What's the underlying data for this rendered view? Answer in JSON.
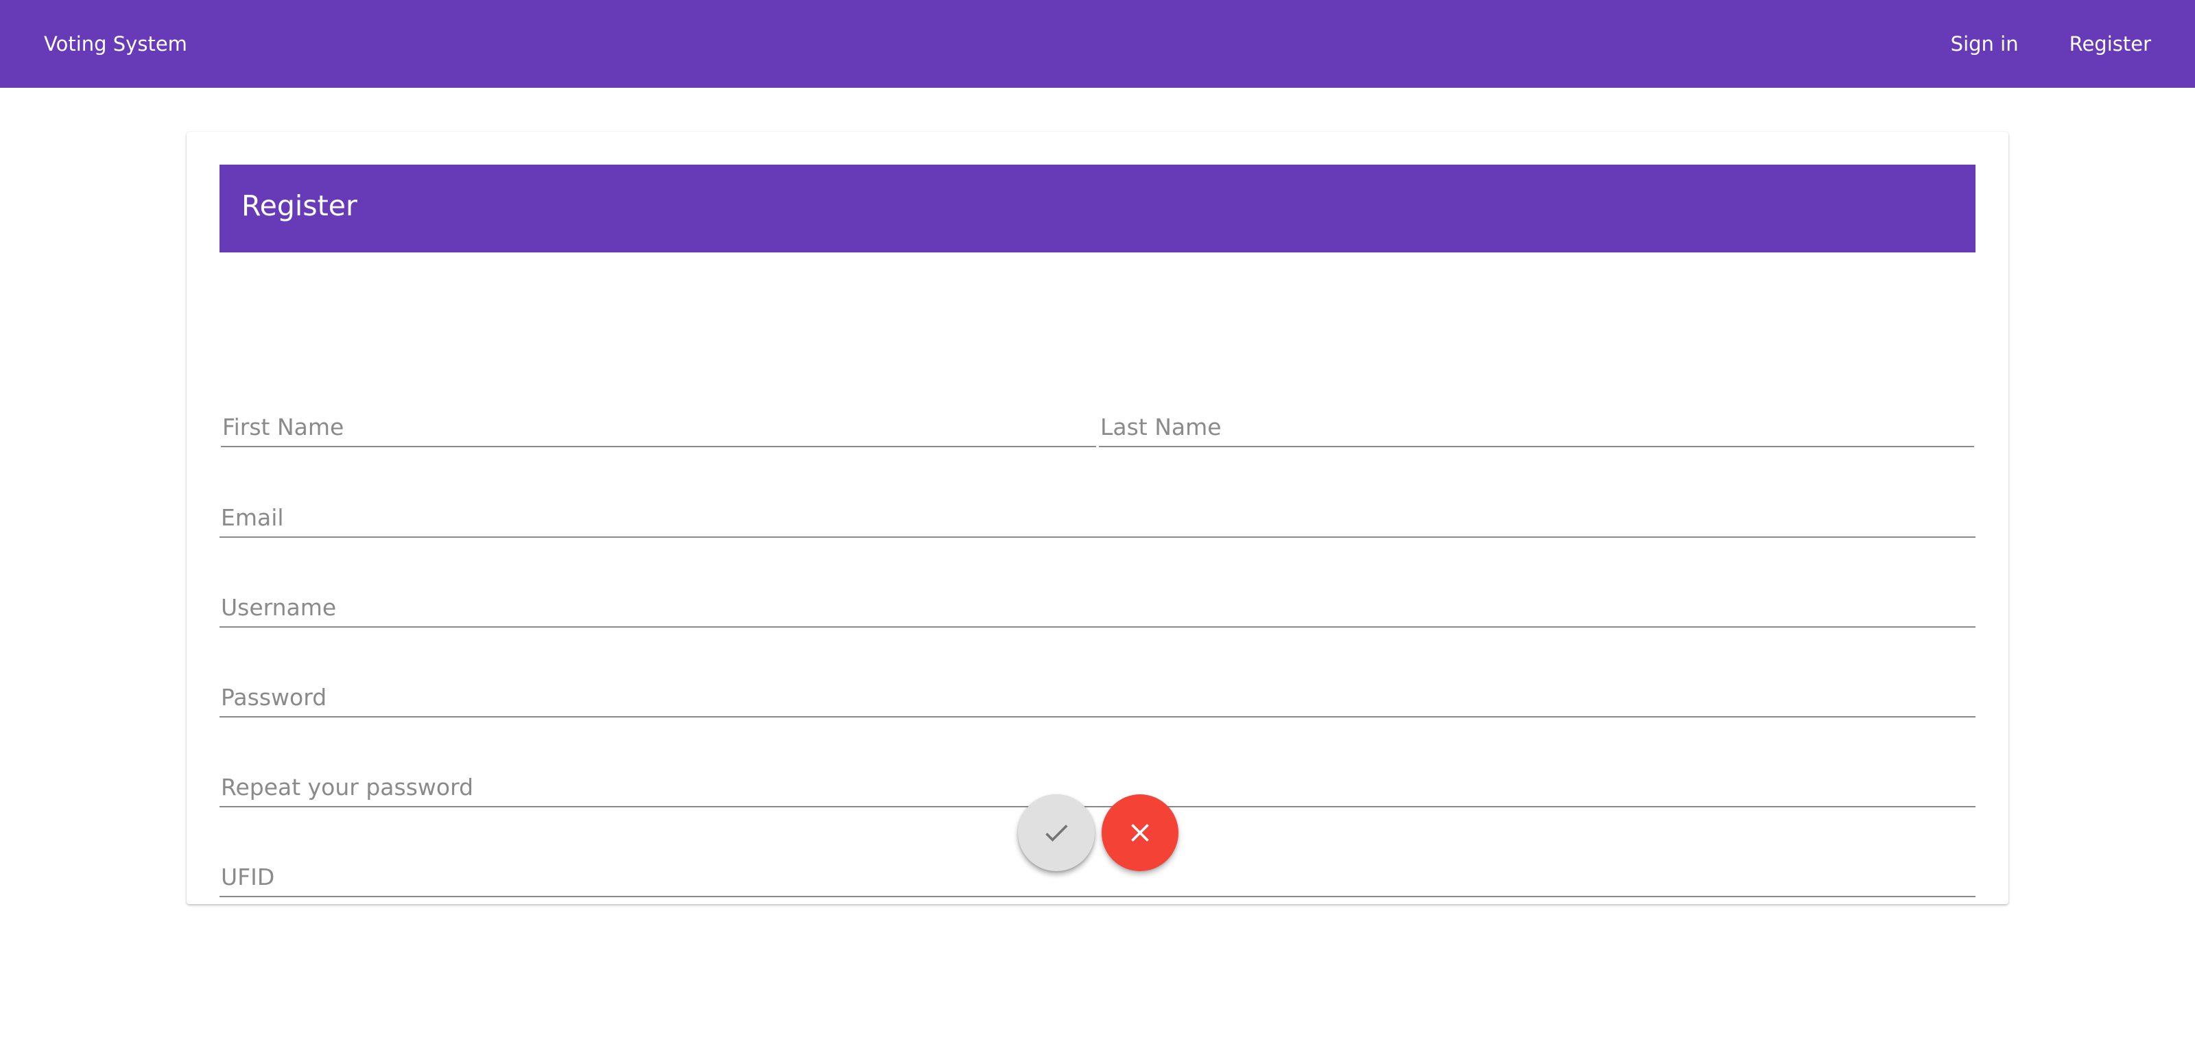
{
  "app": {
    "title": "Voting System",
    "nav": {
      "sign_in": "Sign in",
      "register": "Register"
    }
  },
  "form": {
    "title": "Register",
    "fields": {
      "first_name": {
        "placeholder": "First Name",
        "value": ""
      },
      "last_name": {
        "placeholder": "Last Name",
        "value": ""
      },
      "email": {
        "placeholder": "Email",
        "value": ""
      },
      "username": {
        "placeholder": "Username",
        "value": ""
      },
      "password": {
        "placeholder": "Password",
        "value": ""
      },
      "repeat_password": {
        "placeholder": "Repeat your password",
        "value": ""
      },
      "ufid": {
        "placeholder": "UFID",
        "value": ""
      }
    },
    "actions": {
      "submit_icon": "check-icon",
      "cancel_icon": "close-icon"
    }
  },
  "colors": {
    "primary": "#673AB7",
    "accent": "#F44336",
    "disabled_button": "#E0E0E0"
  }
}
